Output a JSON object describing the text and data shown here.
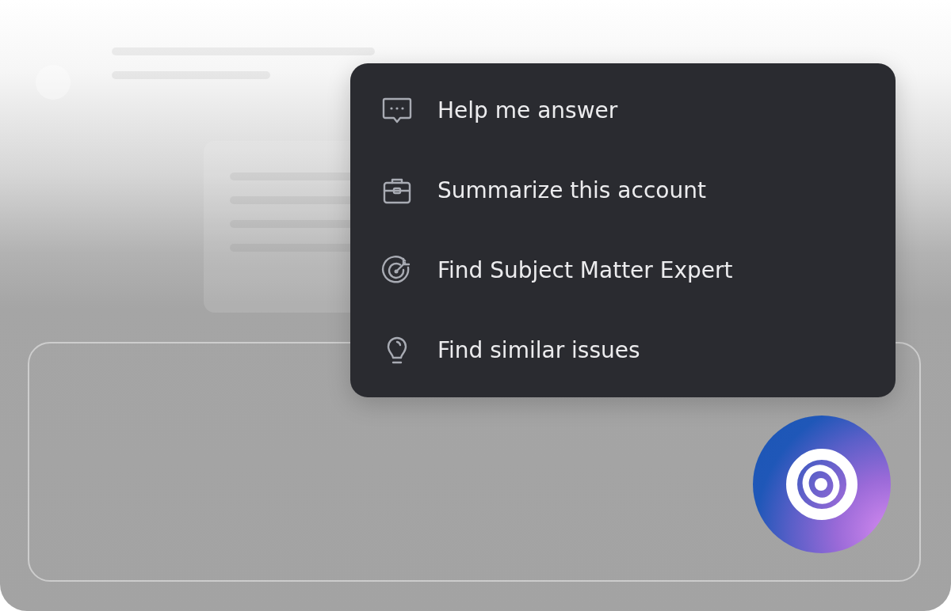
{
  "menu": {
    "items": [
      {
        "kind": "chat",
        "label": "Help me answer"
      },
      {
        "kind": "briefcase",
        "label": "Summarize this account"
      },
      {
        "kind": "target",
        "label": "Find Subject Matter Expert"
      },
      {
        "kind": "bulb",
        "label": "Find similar issues"
      }
    ]
  }
}
